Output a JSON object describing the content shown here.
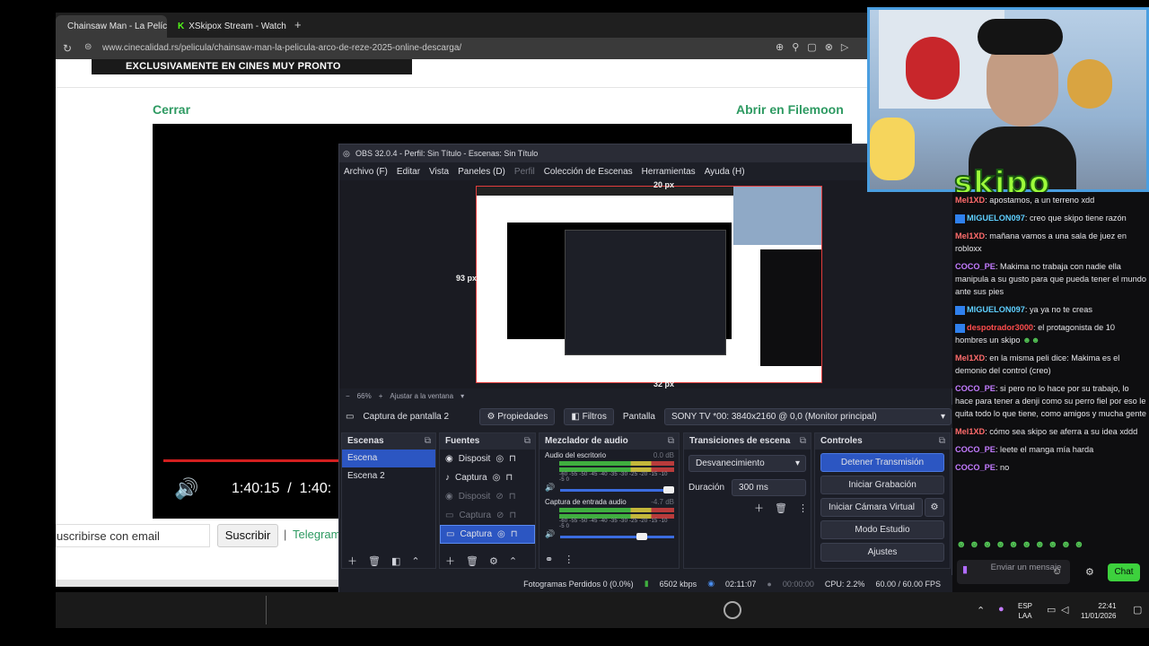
{
  "browser": {
    "tabs": [
      {
        "label": "Chainsaw Man - La Pelícu",
        "icon": "cinecalidad-icon"
      },
      {
        "label": "XSkipox Stream - Watch Li",
        "icon": "kick-icon"
      }
    ],
    "new_tab": "+",
    "url": "www.cinecalidad.rs/pelicula/chainsaw-man-la-pelicula-arco-de-reze-2025-online-descarga/",
    "banner_text": "EXCLUSIVAMENTE EN CINES MUY PRONTO",
    "close_link": "Cerrar",
    "filemoon_link": "Abrir en Filemoon",
    "player_time": "1:40:15  /  1:40:",
    "subscribe_placeholder": "uscribirse con email",
    "subscribe_button": "Suscribir",
    "telegram_link": "Telegram",
    "separator": "|"
  },
  "obs": {
    "title": "OBS 32.0.4 - Perfil: Sin Título - Escenas: Sin Título",
    "menu": [
      "Archivo (F)",
      "Editar",
      "Vista",
      "Paneles (D)",
      "Perfil",
      "Colección de Escenas",
      "Herramientas",
      "Ayuda (H)"
    ],
    "preview_labels": {
      "top": "20 px",
      "left": "93 px",
      "bottom": "32 px"
    },
    "zoom": {
      "minus": "−",
      "percent": "66%",
      "plus": "+",
      "fit": "Ajustar a la ventana"
    },
    "source_bar": {
      "source_name": "Captura de pantalla 2",
      "properties": "Propiedades",
      "filters": "Filtros",
      "screen_label": "Pantalla",
      "screen_value": "SONY TV  *00: 3840x2160 @ 0,0 (Monitor principal)"
    },
    "docks": {
      "scenes": {
        "title": "Escenas",
        "items": [
          "Escena",
          "Escena 2"
        ]
      },
      "sources": {
        "title": "Fuentes",
        "items": [
          "Disposit",
          "Captura",
          "Disposit",
          "Captura",
          "Captura"
        ]
      },
      "mixer": {
        "title": "Mezclador de audio",
        "channels": [
          {
            "name": "Audio del escritorio",
            "db": "0.0 dB"
          },
          {
            "name": "Captura de entrada audio",
            "db": "-4.7 dB"
          }
        ],
        "scale": "-60 -55 -50 -45 -40 -35 -30 -25 -20 -15 -10  -5   0"
      },
      "transitions": {
        "title": "Transiciones de escena",
        "value": "Desvanecimiento",
        "duration_label": "Duración",
        "duration_value": "300 ms"
      },
      "controls": {
        "title": "Controles",
        "buttons": [
          "Detener Transmisión",
          "Iniciar Grabación",
          "Iniciar Cámara Virtual",
          "Modo Estudio",
          "Ajustes"
        ]
      }
    },
    "status": {
      "dropped": "Fotogramas Perdidos 0 (0.0%)",
      "bitrate": "6502 kbps",
      "stream_time": "02:11:07",
      "rec_time": "00:00:00",
      "cpu": "CPU: 2.2%",
      "fps": "60.00 / 60.00 FPS"
    }
  },
  "stream": {
    "logo_text": "skipo"
  },
  "chat": {
    "messages": [
      {
        "user": "Mel1XD",
        "color": "#ff6b6b",
        "text": ": apostamos, a un terreno xdd",
        "badge": false
      },
      {
        "user": "MIGUELON097",
        "color": "#5ecfff",
        "text": ": creo que skipo tiene razón",
        "badge": true
      },
      {
        "user": "Mel1XD",
        "color": "#ff6b6b",
        "text": ": mañana vamos a una sala de juez en robloxx",
        "badge": false
      },
      {
        "user": "COCO_PE",
        "color": "#c37bff",
        "text": ": Makima no trabaja con nadie ella manipula a su gusto para que pueda tener el mundo ante sus pies",
        "badge": false
      },
      {
        "user": "MIGUELON097",
        "color": "#5ecfff",
        "text": ": ya ya no te creas",
        "badge": true
      },
      {
        "user": "despotrador3000",
        "color": "#ff4d4d",
        "text": ": el protagonista de 10 hombres un skipo",
        "badge": true
      },
      {
        "user": "Mel1XD",
        "color": "#ff6b6b",
        "text": ": en la misma peli dice: Makima es el demonio del control (creo)",
        "badge": false
      },
      {
        "user": "COCO_PE",
        "color": "#c37bff",
        "text": ": si pero no lo hace por su trabajo, lo hace para tener a denji como su perro fiel por eso le quita todo lo que tiene, como amigos y mucha gente",
        "badge": false
      },
      {
        "user": "Mel1XD",
        "color": "#ff6b6b",
        "text": ": cómo sea skipo se aferra a su idea xddd",
        "badge": false
      },
      {
        "user": "COCO_PE",
        "color": "#c37bff",
        "text": ": leete el manga mía harda",
        "badge": false
      },
      {
        "user": "COCO_PE",
        "color": "#c37bff",
        "text": ": no",
        "badge": false
      }
    ],
    "input_placeholder": "Enviar un mensaje",
    "send_button": "Chat"
  },
  "taskbar": {
    "language": "ESP",
    "layout": "LAA",
    "time": "22:41",
    "date": "11/01/2026"
  }
}
